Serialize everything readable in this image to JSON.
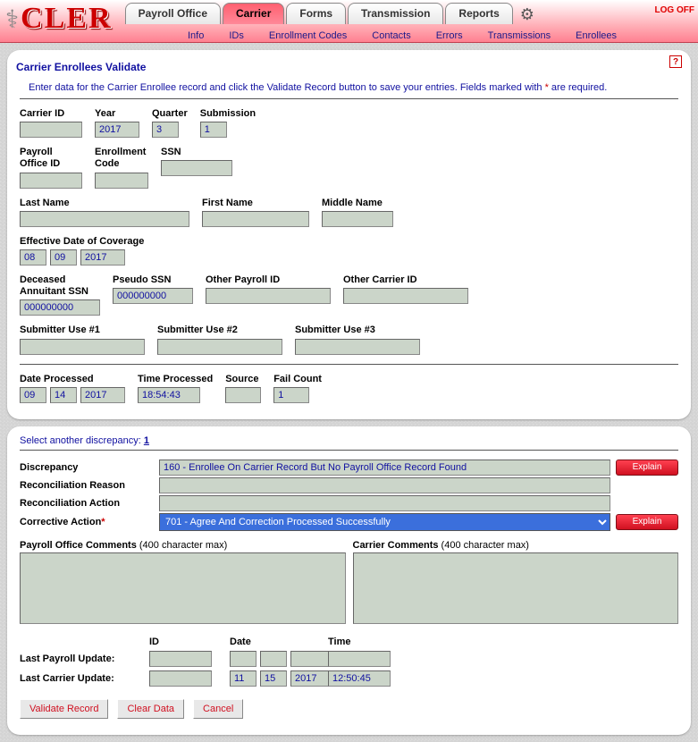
{
  "app": {
    "name": "CLER"
  },
  "nav": {
    "tabs": [
      "Payroll Office",
      "Carrier",
      "Forms",
      "Transmission",
      "Reports"
    ],
    "active_index": 1,
    "sub": [
      "Info",
      "IDs",
      "Enrollment Codes",
      "Contacts",
      "Errors",
      "Transmissions",
      "Enrollees"
    ],
    "logoff": "LOG OFF"
  },
  "panel1": {
    "title": "Carrier Enrollees Validate",
    "intro_a": "Enter data for the Carrier Enrollee record and click the Validate Record button to save your entries.  Fields marked with ",
    "intro_star": "*",
    "intro_b": " are required.",
    "labels": {
      "carrier_id": "Carrier ID",
      "year": "Year",
      "quarter": "Quarter",
      "submission": "Submission",
      "payroll_office_id": "Payroll\nOffice ID",
      "enrollment_code": "Enrollment\nCode",
      "ssn": "SSN",
      "last_name": "Last Name",
      "first_name": "First Name",
      "middle_name": "Middle Name",
      "eff_date": "Effective Date of Coverage",
      "deceased_ssn": "Deceased\nAnnuitant SSN",
      "pseudo_ssn": "Pseudo SSN",
      "other_payroll_id": "Other Payroll ID",
      "other_carrier_id": "Other Carrier ID",
      "sub1": "Submitter Use #1",
      "sub2": "Submitter Use #2",
      "sub3": "Submitter Use #3",
      "date_proc": "Date Processed",
      "time_proc": "Time Processed",
      "source": "Source",
      "fail_count": "Fail Count"
    },
    "values": {
      "carrier_id": "",
      "year": "2017",
      "quarter": "3",
      "submission": "1",
      "payroll_office_id": "",
      "enrollment_code": "",
      "ssn": "",
      "last_name": "",
      "first_name": "",
      "middle_name": "",
      "eff_mm": "08",
      "eff_dd": "09",
      "eff_yy": "2017",
      "deceased_ssn": "000000000",
      "pseudo_ssn": "000000000",
      "other_payroll_id": "",
      "other_carrier_id": "",
      "sub1": "",
      "sub2": "",
      "sub3": "",
      "dp_mm": "09",
      "dp_dd": "14",
      "dp_yy": "2017",
      "time_proc": "18:54:43",
      "source": "",
      "fail_count": "1"
    }
  },
  "panel2": {
    "select_label": "Select another discrepancy:",
    "select_link": "1",
    "rows": {
      "discrepancy_label": "Discrepancy",
      "discrepancy_value": "160 - Enrollee On Carrier Record But No Payroll Office Record Found",
      "recon_reason_label": "Reconciliation Reason",
      "recon_reason_value": "",
      "recon_action_label": "Reconciliation Action",
      "recon_action_value": "",
      "corrective_label": "Corrective Action",
      "corrective_value": "701 - Agree And Correction Processed Successfully"
    },
    "explain": "Explain",
    "comments": {
      "po_label": "Payroll Office Comments",
      "cc_label": "Carrier Comments",
      "limit": "(400 character max)"
    },
    "updates": {
      "id_h": "ID",
      "date_h": "Date",
      "time_h": "Time",
      "row1_label": "Last Payroll Update:",
      "row2_label": "Last Carrier Update:",
      "r1_id": "",
      "r1_mm": "",
      "r1_dd": "",
      "r1_yy": "",
      "r1_time": "",
      "r2_id": "",
      "r2_mm": "11",
      "r2_dd": "15",
      "r2_yy": "2017",
      "r2_time": "12:50:45"
    },
    "buttons": {
      "validate": "Validate Record",
      "clear": "Clear Data",
      "cancel": "Cancel"
    }
  }
}
